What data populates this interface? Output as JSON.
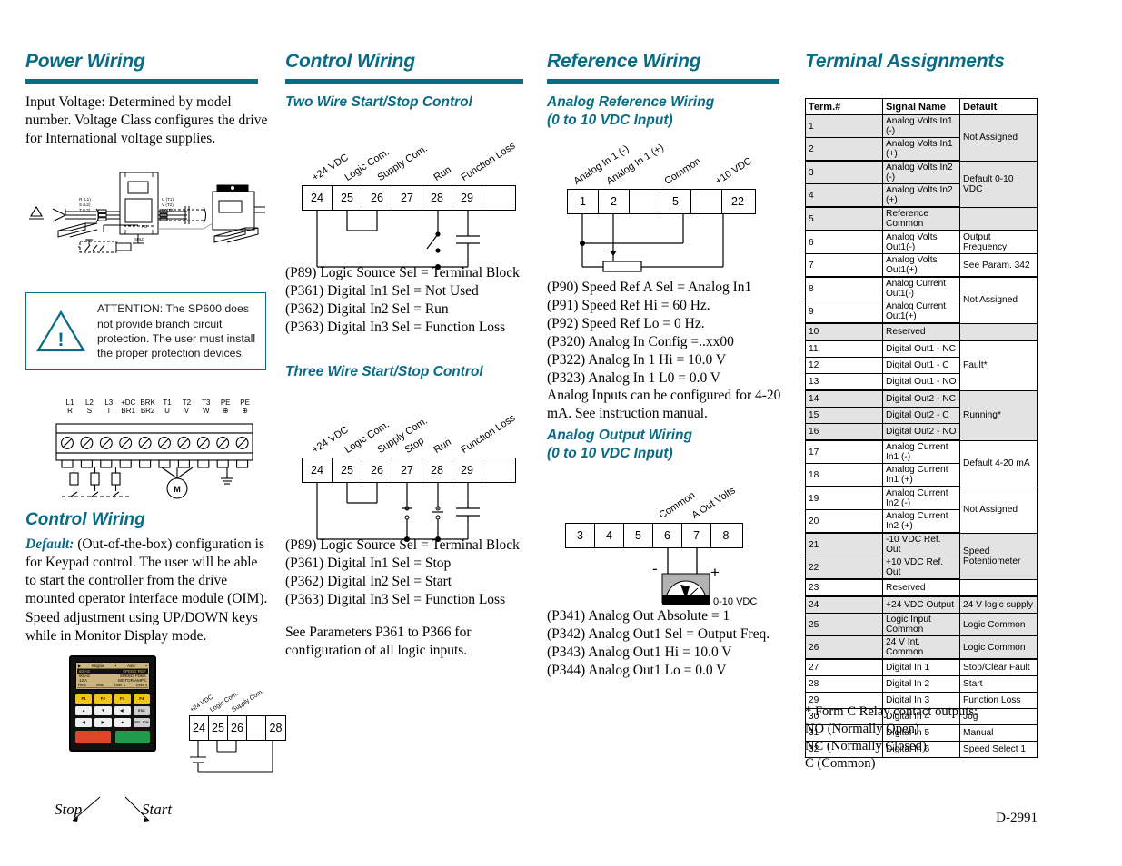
{
  "doc": {
    "code": "D-2991"
  },
  "power": {
    "heading": "Power Wiring",
    "intro": "Input Voltage: Determined by model number. Voltage Class configures the drive for International voltage supplies.",
    "attention": "ATTENTION: The SP600 does not provide branch circuit protection. The user must install the proper protection devices.",
    "diagram_labels": {
      "input": [
        "R (L1)",
        "S (L2)",
        "T (L3)"
      ],
      "output": [
        "U (T1)",
        "V (T2)",
        "W (T3)"
      ],
      "ground": "PE",
      "shield": "SHLD"
    },
    "terminal_strip": [
      {
        "top": "L1",
        "bottom": "R"
      },
      {
        "top": "L2",
        "bottom": "S"
      },
      {
        "top": "L3",
        "bottom": "T"
      },
      {
        "top": "+DC",
        "bottom": "BR1"
      },
      {
        "top": "BRK",
        "bottom": "BR2"
      },
      {
        "top": "T1",
        "bottom": "U"
      },
      {
        "top": "T2",
        "bottom": "V"
      },
      {
        "top": "T3",
        "bottom": "W"
      },
      {
        "top": "PE",
        "bottom": "⊕"
      },
      {
        "top": "PE",
        "bottom": "⊕"
      }
    ],
    "motor_label": "M"
  },
  "control_left": {
    "heading": "Control Wiring",
    "default_lead": "Default:",
    "body": "(Out-of-the-box) configuration is for Keypad control. The user will be able to start the controller from the drive mounted operator interface module (OIM). Speed adjustment using UP/DOWN keys while in Monitor Display mode.",
    "keypad": {
      "status_bar": [
        "▶",
        "Keypad",
        "▪",
        "Auto",
        "▪"
      ],
      "lines": [
        {
          "value": "60 Hz",
          "label": "SPEED REF"
        },
        {
          "value": "60 Hz",
          "label": "SPEED FDBK"
        },
        {
          "value": "12 A",
          "label": "MOTOR AMPS"
        }
      ],
      "soft_keys": [
        "Rest",
        "Mon",
        "User 3",
        "User 4"
      ],
      "fkeys": [
        "F1",
        "F2",
        "F3",
        "F4"
      ],
      "nav_keys": [
        "▲",
        "▼",
        "◀)",
        "ESC PROG",
        "◀",
        "▶",
        "●",
        "SEL JOG"
      ],
      "stop_label": "Stop",
      "start_label": "Start"
    },
    "mini_diagram": {
      "terminals": [
        "24",
        "25",
        "26",
        "",
        "28"
      ],
      "labels": [
        "+24 VDC",
        "Logic Com.",
        "Supply Com."
      ]
    }
  },
  "control": {
    "heading": "Control Wiring",
    "two_wire": {
      "title": "Two Wire Start/Stop Control",
      "terminals": [
        "24",
        "25",
        "26",
        "27",
        "28",
        "29",
        ""
      ],
      "labels": [
        "+24 VDC",
        "Logic Com.",
        "Supply Com.",
        "Run",
        "Function Loss"
      ],
      "params": [
        "(P89) Logic Source Sel = Terminal Block",
        "(P361) Digital In1 Sel = Not Used",
        "(P362) Digital In2 Sel = Run",
        "(P363) Digital In3 Sel = Function Loss"
      ]
    },
    "three_wire": {
      "title": "Three Wire Start/Stop Control",
      "terminals": [
        "24",
        "25",
        "26",
        "27",
        "28",
        "29",
        ""
      ],
      "labels": [
        "+24 VDC",
        "Logic Com.",
        "Supply Com.",
        "Stop",
        "Run",
        "Function Loss"
      ],
      "params": [
        "(P89) Logic Source Sel = Terminal Block",
        "(P361) Digital In1 Sel = Stop",
        "(P362) Digital In2 Sel = Start",
        "(P363) Digital In3 Sel = Function Loss"
      ],
      "note": "See Parameters P361 to P366 for configuration of all logic inputs."
    }
  },
  "reference": {
    "heading": "Reference Wiring",
    "analog_ref": {
      "title_line1": "Analog Reference Wiring",
      "title_line2": "(0 to 10 VDC Input)",
      "terminals": [
        "1",
        "2",
        "",
        "5",
        "",
        "22"
      ],
      "labels": [
        "Analog In 1 (-)",
        "Analog In 1 (+)",
        "Common",
        "+10 VDC"
      ],
      "params": [
        "(P90) Speed Ref A Sel = Analog In1",
        "(P91) Speed Ref Hi = 60 Hz.",
        "(P92) Speed Ref Lo = 0 Hz.",
        "(P320) Analog In Config =..xx00",
        "(P322) Analog In 1 Hi = 10.0 V",
        "(P323) Analog In 1 L0 = 0.0 V"
      ],
      "note": "Analog Inputs can be configured for 4-20 mA. See instruction manual."
    },
    "analog_out": {
      "title_line1": "Analog Output Wiring",
      "title_line2": "(0 to 10 VDC Input)",
      "terminals": [
        "3",
        "4",
        "5",
        "6",
        "7",
        "8"
      ],
      "labels": [
        "Common",
        "A Out Volts"
      ],
      "meter_minus": "-",
      "meter_plus": "+",
      "meter_range": "0-10 VDC",
      "params": [
        "(P341) Analog Out Absolute = 1",
        "(P342) Analog Out1 Sel = Output Freq.",
        "(P343) Analog Out1 Hi  = 10.0 V",
        "(P344) Analog Out1 Lo  = 0.0 V"
      ]
    }
  },
  "terminal": {
    "heading": "Terminal Assignments",
    "columns": [
      "Term.#",
      "Signal Name",
      "Default"
    ],
    "rows": [
      {
        "num": "1",
        "sig": "Analog Volts In1 (-)",
        "shade": true,
        "tight": false
      },
      {
        "num": "2",
        "sig": "Analog Volts In1 (+)",
        "shade": true,
        "tight": false
      },
      {
        "num": "3",
        "sig": "Analog Volts In2 (-)",
        "shade": true,
        "tight": false
      },
      {
        "num": "4",
        "sig": "Analog Volts In2 (+)",
        "shade": true,
        "tight": false
      },
      {
        "num": "5",
        "sig": "Reference Common",
        "shade": true,
        "tight": false
      },
      {
        "num": "6",
        "sig": "Analog Volts Out1(-)",
        "shade": false,
        "tight": false
      },
      {
        "num": "7",
        "sig": "Analog Volts Out1(+)",
        "shade": false,
        "tight": false
      },
      {
        "num": "8",
        "sig": "Analog Current Out1(-)",
        "shade": false,
        "tight": true
      },
      {
        "num": "9",
        "sig": "Analog Current Out1(+)",
        "shade": false,
        "tight": true
      },
      {
        "num": "10",
        "sig": "Reserved",
        "shade": true,
        "tight": false
      },
      {
        "num": "11",
        "sig": "Digital Out1 - NC",
        "shade": false,
        "tight": false
      },
      {
        "num": "12",
        "sig": "Digital Out1 - C",
        "shade": false,
        "tight": false
      },
      {
        "num": "13",
        "sig": "Digital Out1 - NO",
        "shade": false,
        "tight": false
      },
      {
        "num": "14",
        "sig": "Digital Out2 - NC",
        "shade": true,
        "tight": false
      },
      {
        "num": "15",
        "sig": "Digital Out2 - C",
        "shade": true,
        "tight": false
      },
      {
        "num": "16",
        "sig": "Digital Out2 - NO",
        "shade": true,
        "tight": false
      },
      {
        "num": "17",
        "sig": "Analog Current In1 (-)",
        "shade": false,
        "tight": false
      },
      {
        "num": "18",
        "sig": "Analog Current In1 (+)",
        "shade": false,
        "tight": false
      },
      {
        "num": "19",
        "sig": "Analog Current In2 (-)",
        "shade": false,
        "tight": false
      },
      {
        "num": "20",
        "sig": "Analog Current In2 (+)",
        "shade": false,
        "tight": false
      },
      {
        "num": "21",
        "sig": "-10 VDC Ref. Out",
        "shade": true,
        "tight": false
      },
      {
        "num": "22",
        "sig": "+10 VDC Ref. Out",
        "shade": true,
        "tight": false
      },
      {
        "num": "23",
        "sig": "Reserved",
        "shade": false,
        "tight": false
      },
      {
        "num": "24",
        "sig": "+24 VDC Output",
        "shade": true,
        "tight": false
      },
      {
        "num": "25",
        "sig": "Logic Input Common",
        "shade": true,
        "tight": false
      },
      {
        "num": "26",
        "sig": "24 V Int. Common",
        "shade": true,
        "tight": false
      },
      {
        "num": "27",
        "sig": "Digital In 1",
        "shade": false,
        "tight": false
      },
      {
        "num": "28",
        "sig": "Digital In 2",
        "shade": false,
        "tight": false
      },
      {
        "num": "29",
        "sig": "Digital In 3",
        "shade": false,
        "tight": false
      },
      {
        "num": "30",
        "sig": "Digital In 4",
        "shade": false,
        "tight": false
      },
      {
        "num": "31",
        "sig": "Digital In 5",
        "shade": false,
        "tight": false
      },
      {
        "num": "32",
        "sig": "Digital In 6",
        "shade": false,
        "tight": false
      }
    ],
    "defaults": [
      {
        "text": "Not Assigned",
        "span": 2,
        "shade": true
      },
      {
        "text": "Default 0-10 VDC",
        "span": 2,
        "shade": true
      },
      {
        "text": "",
        "span": 1,
        "shade": true
      },
      {
        "text": "Output Frequency",
        "span": 1,
        "shade": false
      },
      {
        "text": "See Param. 342",
        "span": 1,
        "shade": false
      },
      {
        "text": "Not Assigned",
        "span": 2,
        "shade": false
      },
      {
        "text": "",
        "span": 1,
        "shade": true
      },
      {
        "text": "Fault*",
        "span": 3,
        "shade": false
      },
      {
        "text": "Running*",
        "span": 3,
        "shade": true
      },
      {
        "text": "Default 4-20 mA",
        "span": 2,
        "shade": false
      },
      {
        "text": "Not Assigned",
        "span": 2,
        "shade": false
      },
      {
        "text": "Speed Potentiometer",
        "span": 2,
        "shade": true
      },
      {
        "text": "",
        "span": 1,
        "shade": false
      },
      {
        "text": "24 V logic supply",
        "span": 1,
        "shade": true
      },
      {
        "text": "Logic Common",
        "span": 1,
        "shade": true
      },
      {
        "text": "Logic Common",
        "span": 1,
        "shade": true
      },
      {
        "text": "Stop/Clear Fault",
        "span": 1,
        "shade": false
      },
      {
        "text": "Start",
        "span": 1,
        "shade": false
      },
      {
        "text": "Function Loss",
        "span": 1,
        "shade": false
      },
      {
        "text": "Jog",
        "span": 1,
        "shade": false
      },
      {
        "text": "Manual",
        "span": 1,
        "shade": false
      },
      {
        "text": "Speed Select 1",
        "span": 1,
        "shade": false
      }
    ],
    "footnotes": [
      "* Form C Relay contact outputs:",
      "NO (Normally Open)",
      "NC (Normally Closed)",
      "C (Common)"
    ]
  },
  "colors": {
    "accent": "#0a6b86",
    "shade": "#e3e3e3"
  }
}
